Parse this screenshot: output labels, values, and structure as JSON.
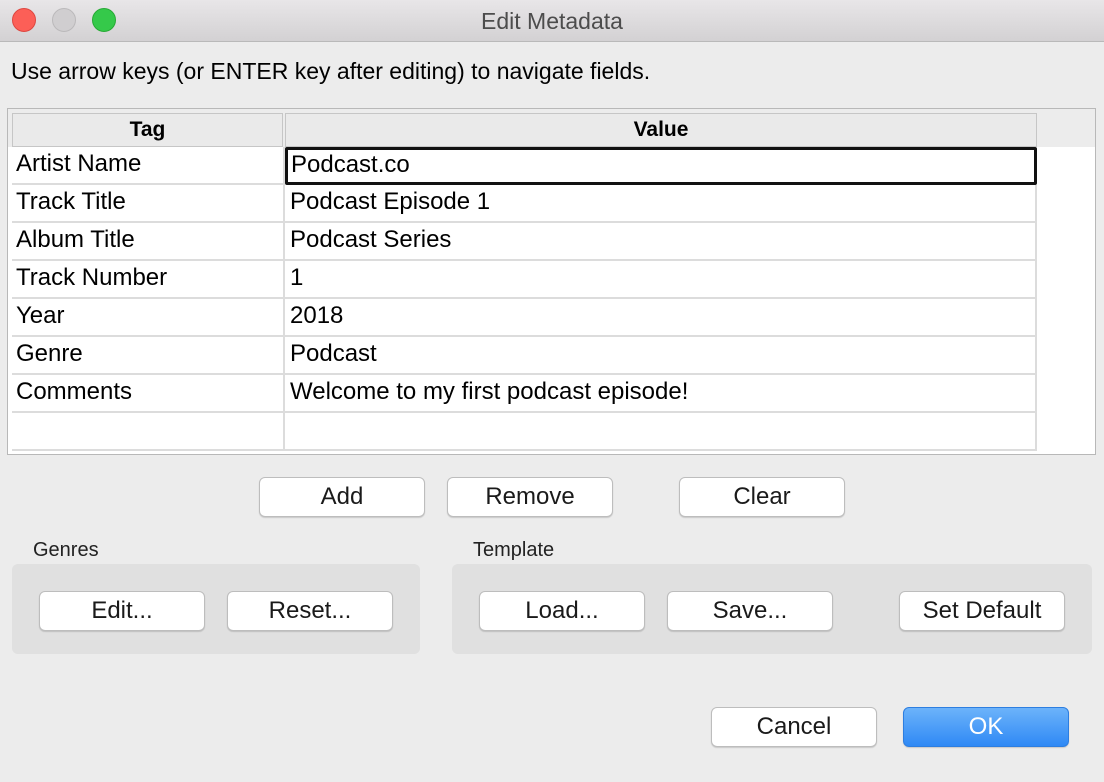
{
  "window": {
    "title": "Edit Metadata"
  },
  "instructions": "Use arrow keys (or ENTER key after editing) to navigate fields.",
  "table": {
    "columns": [
      "Tag",
      "Value"
    ],
    "rows": [
      {
        "tag": "Artist Name",
        "value": "Podcast.co"
      },
      {
        "tag": "Track Title",
        "value": "Podcast Episode 1"
      },
      {
        "tag": "Album Title",
        "value": "Podcast Series"
      },
      {
        "tag": "Track Number",
        "value": "1"
      },
      {
        "tag": "Year",
        "value": "2018"
      },
      {
        "tag": "Genre",
        "value": "Podcast"
      },
      {
        "tag": "Comments",
        "value": "Welcome to my first podcast episode!"
      },
      {
        "tag": "",
        "value": ""
      }
    ]
  },
  "row_actions": {
    "add": "Add",
    "remove": "Remove",
    "clear": "Clear"
  },
  "genres": {
    "label": "Genres",
    "edit": "Edit...",
    "reset": "Reset..."
  },
  "template": {
    "label": "Template",
    "load": "Load...",
    "save": "Save...",
    "set_default": "Set Default"
  },
  "dialog": {
    "cancel": "Cancel",
    "ok": "OK"
  },
  "colors": {
    "ok_button": "#3a8ef6",
    "close": "#fc5f57",
    "maximize": "#35c94a"
  }
}
